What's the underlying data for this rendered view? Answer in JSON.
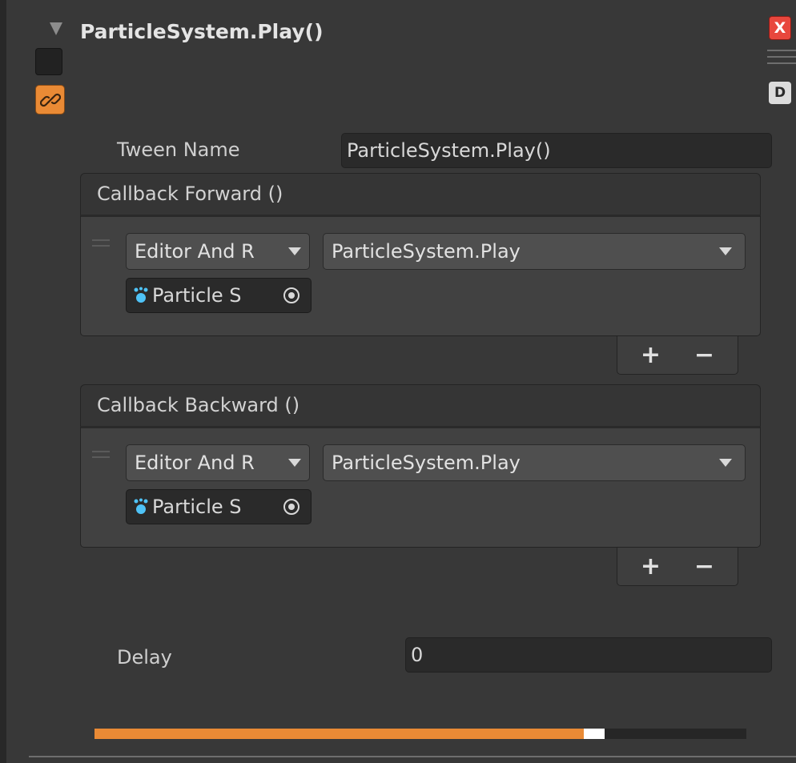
{
  "header": {
    "title": "ParticleSystem.Play()",
    "close_label": "X",
    "debug_label": "D"
  },
  "tween_name": {
    "label": "Tween Name",
    "value": "ParticleSystem.Play()"
  },
  "callbacks": [
    {
      "header": "Callback Forward ()",
      "runtime_mode": "Editor And R",
      "function": "ParticleSystem.Play",
      "target_object": "Particle S",
      "add_label": "+",
      "remove_label": "−"
    },
    {
      "header": "Callback Backward ()",
      "runtime_mode": "Editor And R",
      "function": "ParticleSystem.Play",
      "target_object": "Particle S",
      "add_label": "+",
      "remove_label": "−"
    }
  ],
  "delay": {
    "label": "Delay",
    "value": "0"
  },
  "progress": {
    "fraction": 0.751
  },
  "colors": {
    "accent": "#e98a35",
    "close": "#e8473d",
    "panel": "#383838",
    "particle_icon": "#4fc3f7"
  },
  "icons": {
    "fold": "triangle-down-icon",
    "link": "link-icon",
    "particle": "particle-system-icon",
    "target": "object-picker-icon"
  }
}
